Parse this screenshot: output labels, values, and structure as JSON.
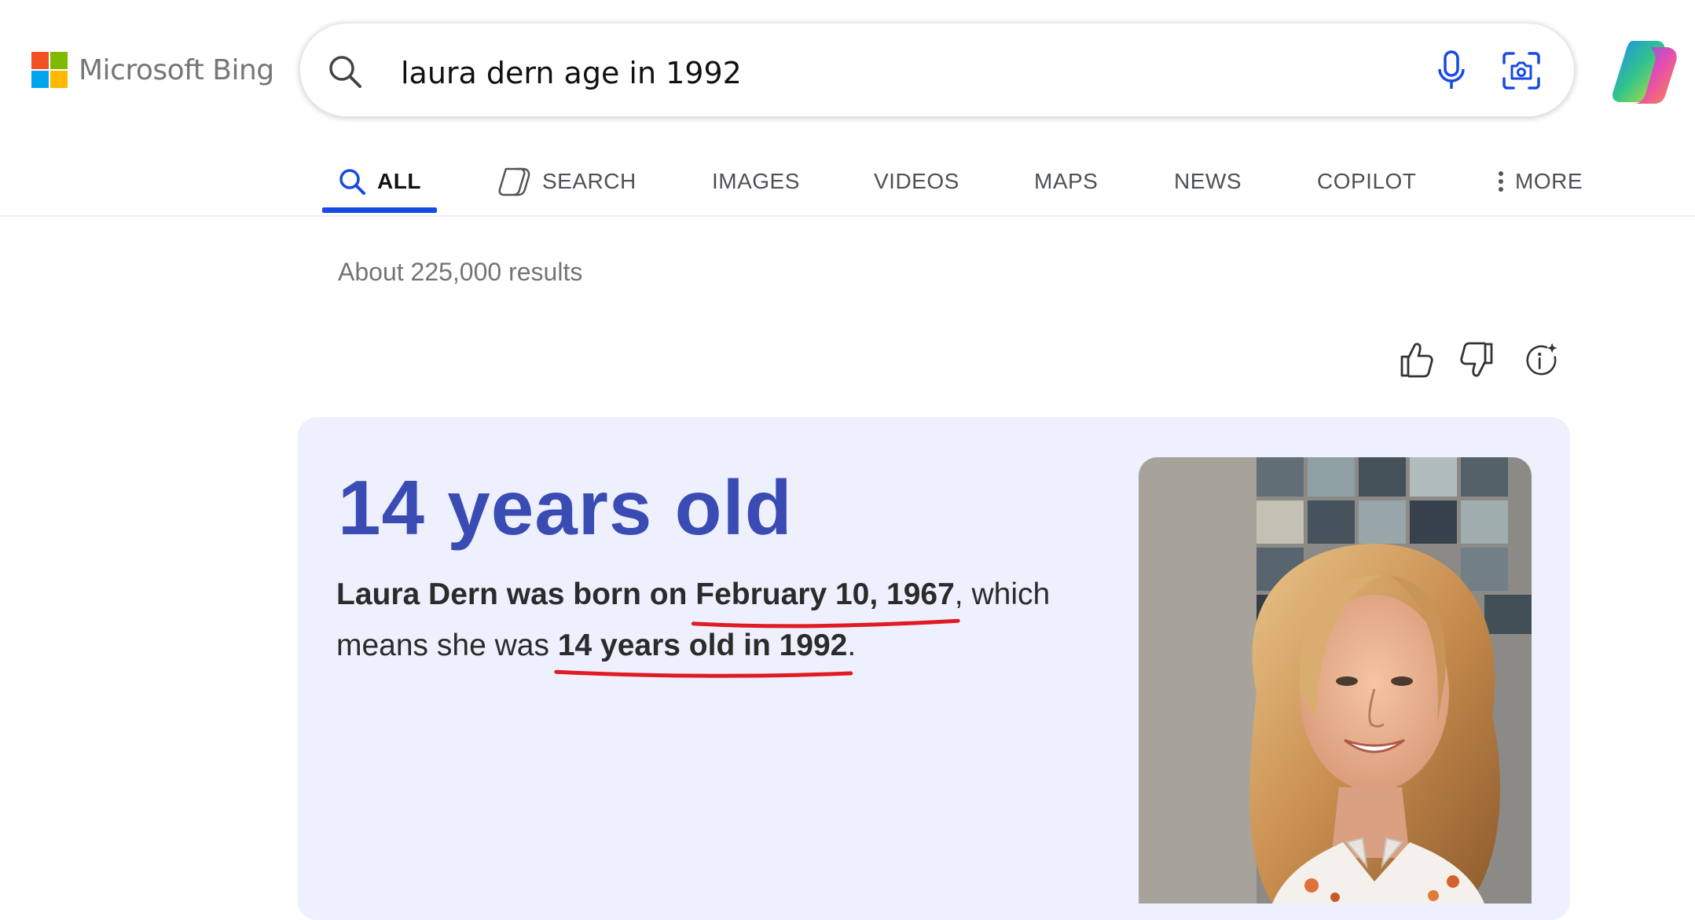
{
  "header": {
    "logo_text": "Microsoft Bing",
    "logo_colors": [
      "#f25022",
      "#7fba00",
      "#00a4ef",
      "#ffb900"
    ],
    "search": {
      "value": "laura dern age in 1992",
      "search_icon": "search-icon",
      "mic_icon": "microphone-icon",
      "visual_search_icon": "visual-search-icon"
    },
    "copilot_icon": "copilot-logo-icon"
  },
  "tabs": [
    {
      "label": "ALL",
      "icon": "search-icon",
      "active": true
    },
    {
      "label": "SEARCH",
      "icon": "copilot-search-icon"
    },
    {
      "label": "IMAGES"
    },
    {
      "label": "VIDEOS"
    },
    {
      "label": "MAPS"
    },
    {
      "label": "NEWS"
    },
    {
      "label": "COPILOT"
    },
    {
      "label": "MORE",
      "icon": "more-vertical-icon"
    }
  ],
  "results_count": "About 225,000 results",
  "feedback": {
    "thumbs_up_icon": "thumbs-up-icon",
    "thumbs_down_icon": "thumbs-down-icon",
    "info_icon": "ai-info-icon"
  },
  "answer": {
    "title": "14 years old",
    "text_part1": "Laura Dern was born on ",
    "birth_date": "February 10, 1967",
    "text_part2": ", which means she was ",
    "age_phrase": "14 years old in 1992",
    "text_part3": ".",
    "image": "laura-dern-portrait"
  },
  "colors": {
    "accent": "#174ae4",
    "answer_title": "#3a4cb4",
    "card_bg": "#eef0fd",
    "annotation_red": "#e01b24"
  }
}
